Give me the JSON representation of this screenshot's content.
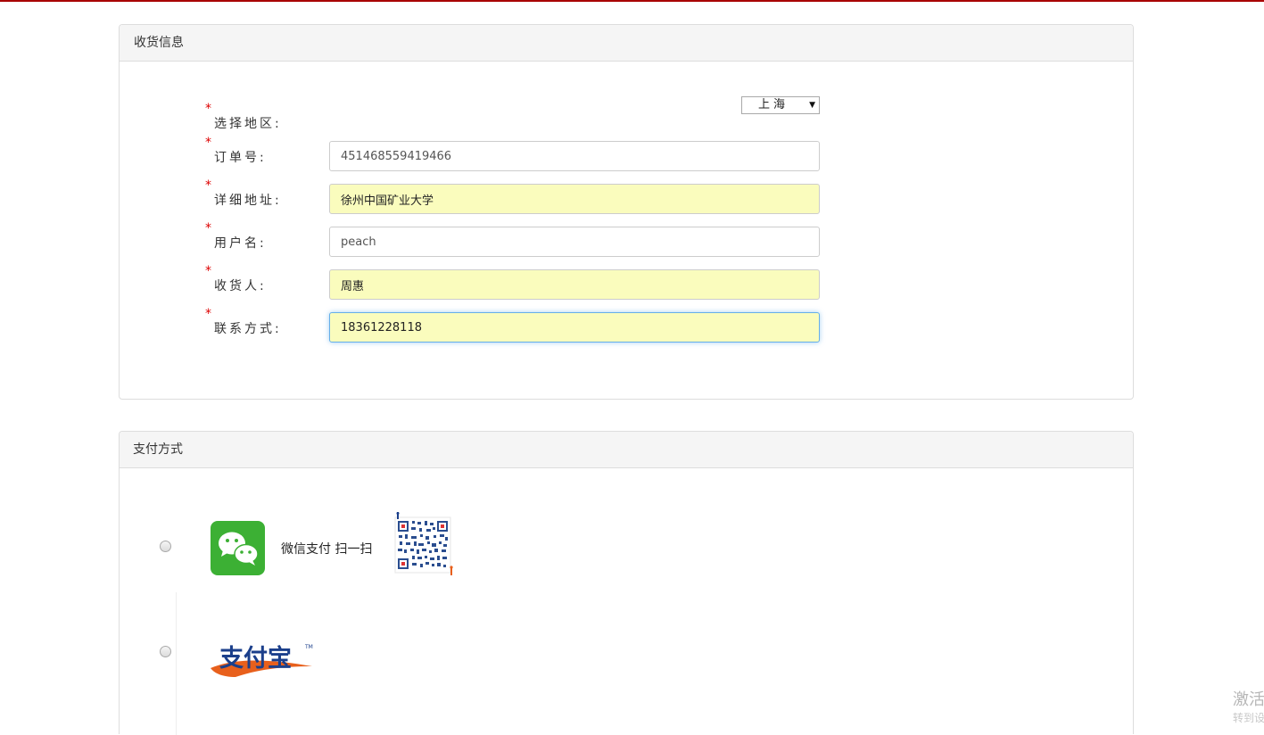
{
  "shipping": {
    "title": "收货信息",
    "region": {
      "label": "选择地区:",
      "required_mark": "*",
      "selected": "上海"
    },
    "fields": [
      {
        "label": "订单号:",
        "required_mark": "*",
        "value": "451468559419466"
      },
      {
        "label": "详细地址:",
        "required_mark": "*",
        "value": "徐州中国矿业大学"
      },
      {
        "label": "用户名:",
        "required_mark": "*",
        "value": "peach"
      },
      {
        "label": "收货人:",
        "required_mark": "*",
        "value": "周惠"
      },
      {
        "label": "联系方式:",
        "required_mark": "*",
        "value": "18361228118"
      }
    ]
  },
  "payment": {
    "title": "支付方式",
    "wechat": {
      "label": "微信支付 扫一扫",
      "icon": "wechat-icon"
    },
    "alipay": {
      "logo_text": "支付宝",
      "trademark": "TM",
      "icon": "alipay-logo"
    }
  },
  "watermark": {
    "text": "激活",
    "sub": "转到设"
  },
  "colors": {
    "accent_top": "#a80000",
    "autofill_bg": "#fafcbd",
    "wechat_green": "#3cb034",
    "alipay_blue": "#1b3f8b",
    "alipay_orange": "#e8601c"
  }
}
